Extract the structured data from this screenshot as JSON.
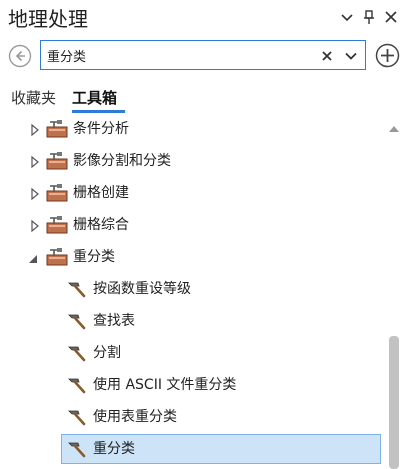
{
  "panel": {
    "title": "地理处理",
    "controls": {
      "options": "▾",
      "pin": "📌",
      "close": "✕"
    }
  },
  "search": {
    "value": "重分类",
    "placeholder": ""
  },
  "tabs": [
    {
      "label": "收藏夹",
      "active": false
    },
    {
      "label": "工具箱",
      "active": true
    }
  ],
  "tree": {
    "items": [
      {
        "label": "条件分析",
        "kind": "toolbox",
        "expanded": false
      },
      {
        "label": "影像分割和分类",
        "kind": "toolbox",
        "expanded": false
      },
      {
        "label": "栅格创建",
        "kind": "toolbox",
        "expanded": false
      },
      {
        "label": "栅格综合",
        "kind": "toolbox",
        "expanded": false
      },
      {
        "label": "重分类",
        "kind": "toolbox",
        "expanded": true
      },
      {
        "label": "按函数重设等级",
        "kind": "tool"
      },
      {
        "label": "查找表",
        "kind": "tool"
      },
      {
        "label": "分割",
        "kind": "tool"
      },
      {
        "label": "使用 ASCII 文件重分类",
        "kind": "tool"
      },
      {
        "label": "使用表重分类",
        "kind": "tool"
      },
      {
        "label": "重分类",
        "kind": "tool",
        "selected": true
      }
    ]
  },
  "colors": {
    "accent": "#2f7bd8",
    "selection": "#cde3f7",
    "toolbox_brown": "#c0704a"
  }
}
